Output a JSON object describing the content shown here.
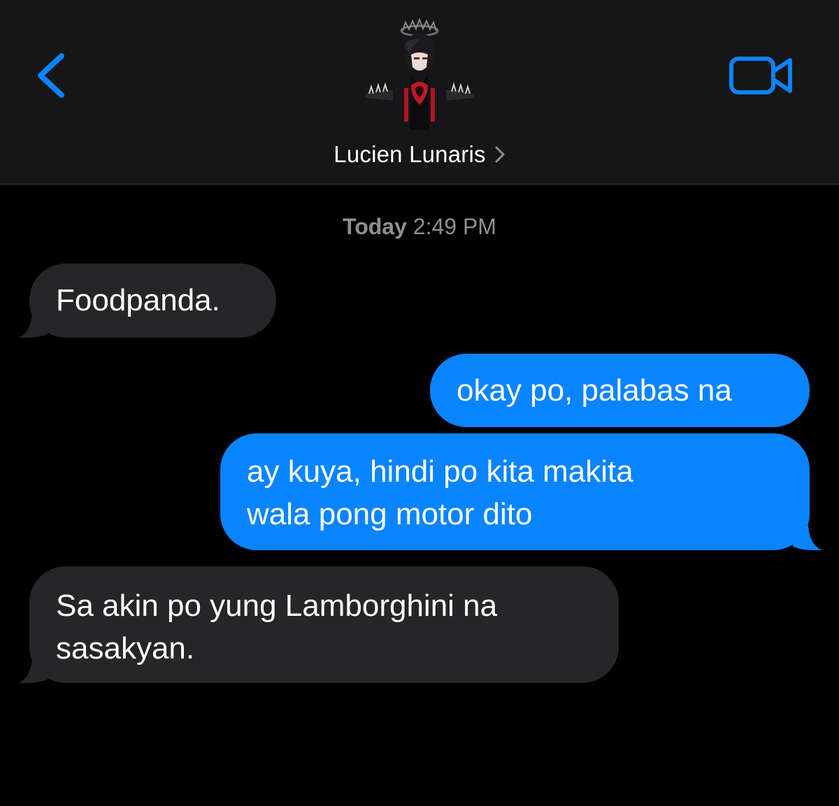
{
  "header": {
    "contact_name": "Lucien Lunaris",
    "back_icon": "chevron-left-icon",
    "video_icon": "video-camera-icon",
    "accent_color": "#0a84ff"
  },
  "thread": {
    "timestamp_day": "Today",
    "timestamp_time": "2:49 PM"
  },
  "messages": [
    {
      "direction": "incoming",
      "lines": [
        "Foodpanda."
      ]
    },
    {
      "direction": "outgoing",
      "lines": [
        "okay po, palabas na"
      ]
    },
    {
      "direction": "outgoing",
      "lines": [
        "ay kuya, hindi po kita makita",
        "wala pong motor dito"
      ]
    },
    {
      "direction": "incoming",
      "lines": [
        "Sa akin po yung Lamborghini na",
        "sasakyan."
      ]
    }
  ],
  "colors": {
    "incoming_bubble": "#262628",
    "outgoing_bubble": "#0a84ff",
    "header_bg": "#161616",
    "timestamp_text": "#8e8e93"
  }
}
